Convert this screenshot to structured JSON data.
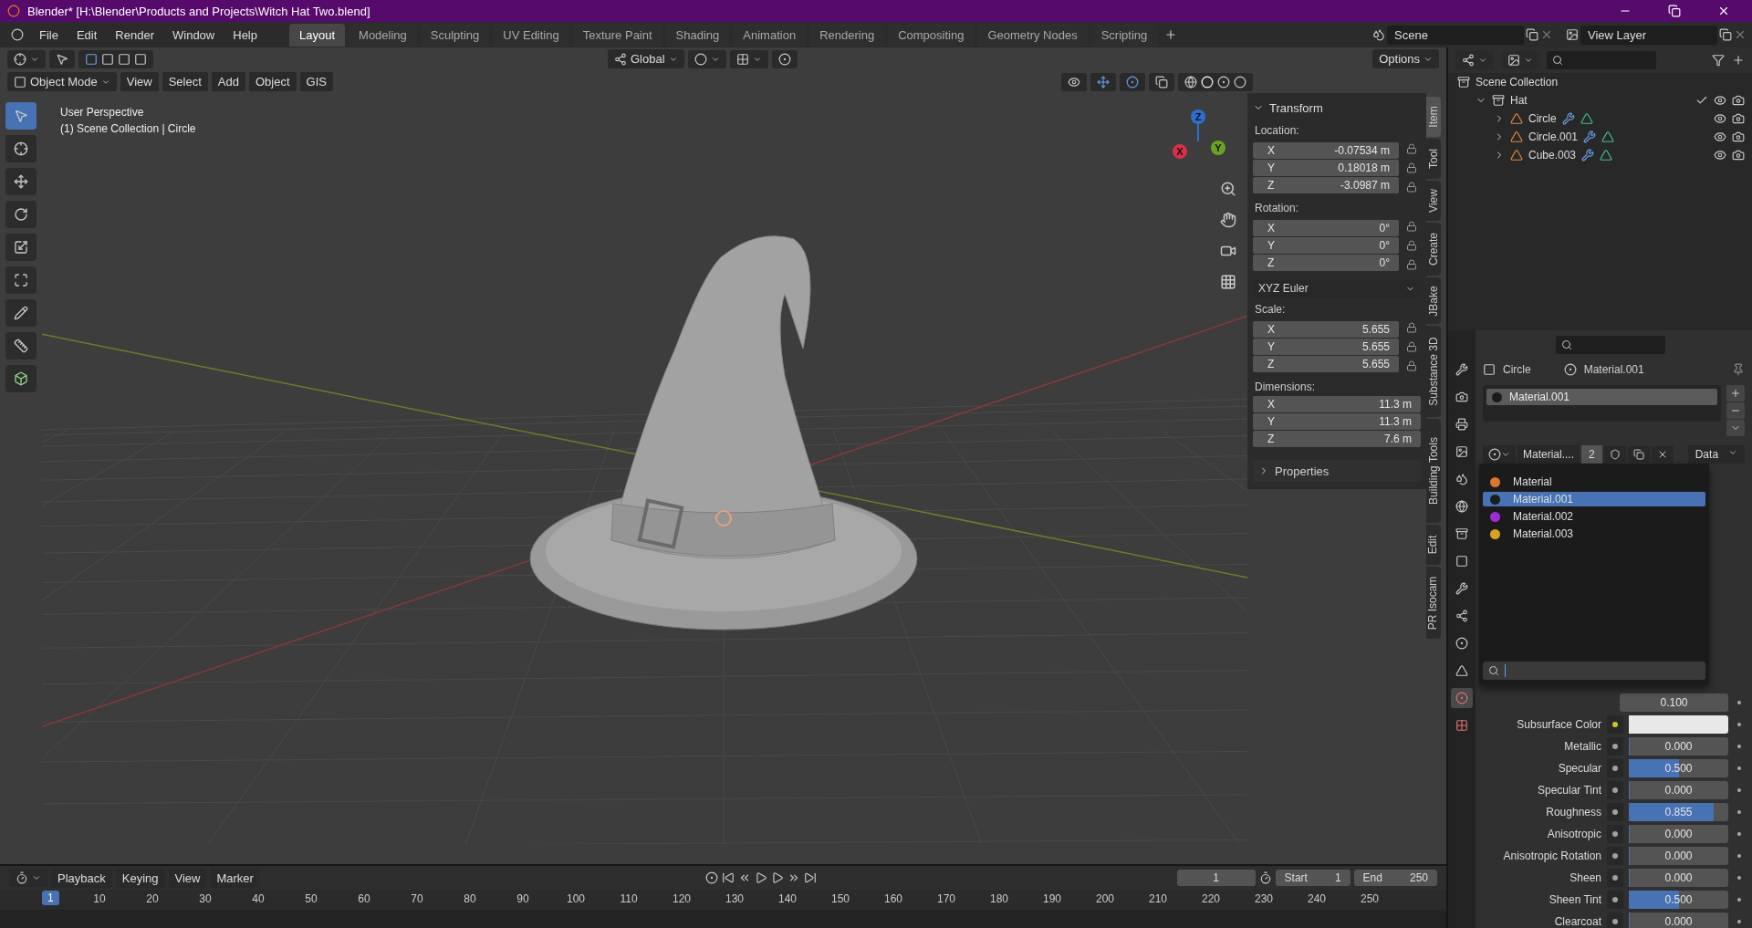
{
  "window": {
    "title": "Blender* [H:\\Blender\\Products and Projects\\Witch Hat Two.blend]"
  },
  "menu": [
    "File",
    "Edit",
    "Render",
    "Window",
    "Help"
  ],
  "workspaces": [
    {
      "label": "Layout",
      "selected": true
    },
    {
      "label": "Modeling",
      "selected": false
    },
    {
      "label": "Sculpting",
      "selected": false
    },
    {
      "label": "UV Editing",
      "selected": false
    },
    {
      "label": "Texture Paint",
      "selected": false
    },
    {
      "label": "Shading",
      "selected": false
    },
    {
      "label": "Animation",
      "selected": false
    },
    {
      "label": "Rendering",
      "selected": false
    },
    {
      "label": "Compositing",
      "selected": false
    },
    {
      "label": "Geometry Nodes",
      "selected": false
    },
    {
      "label": "Scripting",
      "selected": false
    }
  ],
  "scene": "Scene",
  "view_layer": "View Layer",
  "viewport_header": {
    "orientation": "Global",
    "options": "Options",
    "mode": "Object Mode",
    "menus": [
      "View",
      "Select",
      "Add",
      "Object",
      "GIS"
    ]
  },
  "viewport": {
    "overlay_lines": [
      "User Perspective",
      "(1) Scene Collection | Circle"
    ],
    "gizmo_axes": [
      "Z",
      "Y",
      "X"
    ]
  },
  "sidebar": {
    "title": "Transform",
    "groups": [
      {
        "label": "Location:",
        "kind": "locked",
        "fields": [
          {
            "axis": "X",
            "value": "-0.07534 m"
          },
          {
            "axis": "Y",
            "value": "0.18018 m"
          },
          {
            "axis": "Z",
            "value": "-3.0987 m"
          }
        ]
      },
      {
        "label": "Rotation:",
        "kind": "locked",
        "fields": [
          {
            "axis": "X",
            "value": "0°"
          },
          {
            "axis": "Y",
            "value": "0°"
          },
          {
            "axis": "Z",
            "value": "0°"
          }
        ],
        "mode": "XYZ Euler"
      },
      {
        "label": "Scale:",
        "kind": "locked",
        "fields": [
          {
            "axis": "X",
            "value": "5.655"
          },
          {
            "axis": "Y",
            "value": "5.655"
          },
          {
            "axis": "Z",
            "value": "5.655"
          }
        ]
      },
      {
        "label": "Dimensions:",
        "kind": "plain",
        "fields": [
          {
            "axis": "X",
            "value": "11.3 m"
          },
          {
            "axis": "Y",
            "value": "11.3 m"
          },
          {
            "axis": "Z",
            "value": "7.6 m"
          }
        ]
      }
    ],
    "properties": "Properties",
    "tabs": [
      {
        "label": "Item",
        "selected": true
      },
      {
        "label": "Tool",
        "selected": false
      },
      {
        "label": "View",
        "selected": false
      },
      {
        "label": "Create",
        "selected": false
      },
      {
        "label": "JBake",
        "selected": false
      },
      {
        "label": "Substance 3D",
        "selected": false
      },
      {
        "label": "Building Tools",
        "selected": false
      },
      {
        "label": "Edit",
        "selected": false
      },
      {
        "label": "PR Isocam",
        "selected": false
      }
    ]
  },
  "outliner": {
    "root": "Scene Collection",
    "items": [
      {
        "label": "Hat",
        "expanded": true,
        "children": [
          {
            "label": "Circle",
            "expanded": false
          },
          {
            "label": "Circle.001",
            "expanded": false
          },
          {
            "label": "Cube.003",
            "expanded": false
          }
        ]
      }
    ]
  },
  "material_panel": {
    "object": "Circle",
    "material": "Material.001",
    "slots": [
      "Material.001"
    ],
    "material_field": "Material....",
    "users": "2",
    "link": "Data",
    "menu": [
      {
        "label": "Material",
        "color": "#d9772e",
        "selected": false
      },
      {
        "label": "Material.001",
        "color": "#1c1c1c",
        "selected": true
      },
      {
        "label": "Material.002",
        "color": "#a22ad6",
        "selected": false
      },
      {
        "label": "Material.003",
        "color": "#d9a21c",
        "selected": false
      }
    ],
    "rows": [
      {
        "kind": "partial",
        "value": "0.100"
      },
      {
        "kind": "color",
        "label": "Subsurface Color"
      },
      {
        "kind": "slider",
        "label": "Metallic",
        "value": "0.000",
        "level": 0
      },
      {
        "kind": "slider",
        "label": "Specular",
        "value": "0.500",
        "level": 0.5
      },
      {
        "kind": "slider",
        "label": "Specular Tint",
        "value": "0.000",
        "level": 0
      },
      {
        "kind": "slider",
        "label": "Roughness",
        "value": "0.855",
        "level": 0.855
      },
      {
        "kind": "slider",
        "label": "Anisotropic",
        "value": "0.000",
        "level": 0
      },
      {
        "kind": "slider",
        "label": "Anisotropic Rotation",
        "value": "0.000",
        "level": 0
      },
      {
        "kind": "slider",
        "label": "Sheen",
        "value": "0.000",
        "level": 0
      },
      {
        "kind": "slider",
        "label": "Sheen Tint",
        "value": "0.500",
        "level": 0.5
      },
      {
        "kind": "slider",
        "label": "Clearcoat",
        "value": "0.000",
        "level": 0
      }
    ]
  },
  "timeline": {
    "menus": [
      "Playback",
      "Keying",
      "View",
      "Marker"
    ],
    "current_frame": "1",
    "start_label": "Start",
    "start": "1",
    "end_label": "End",
    "end": "250",
    "marker": "1",
    "ruler": [
      "10",
      "20",
      "30",
      "40",
      "50",
      "60",
      "70",
      "80",
      "90",
      "100",
      "110",
      "120",
      "130",
      "140",
      "150",
      "160",
      "170",
      "180",
      "190",
      "200",
      "210",
      "220",
      "230",
      "240",
      "250"
    ]
  }
}
